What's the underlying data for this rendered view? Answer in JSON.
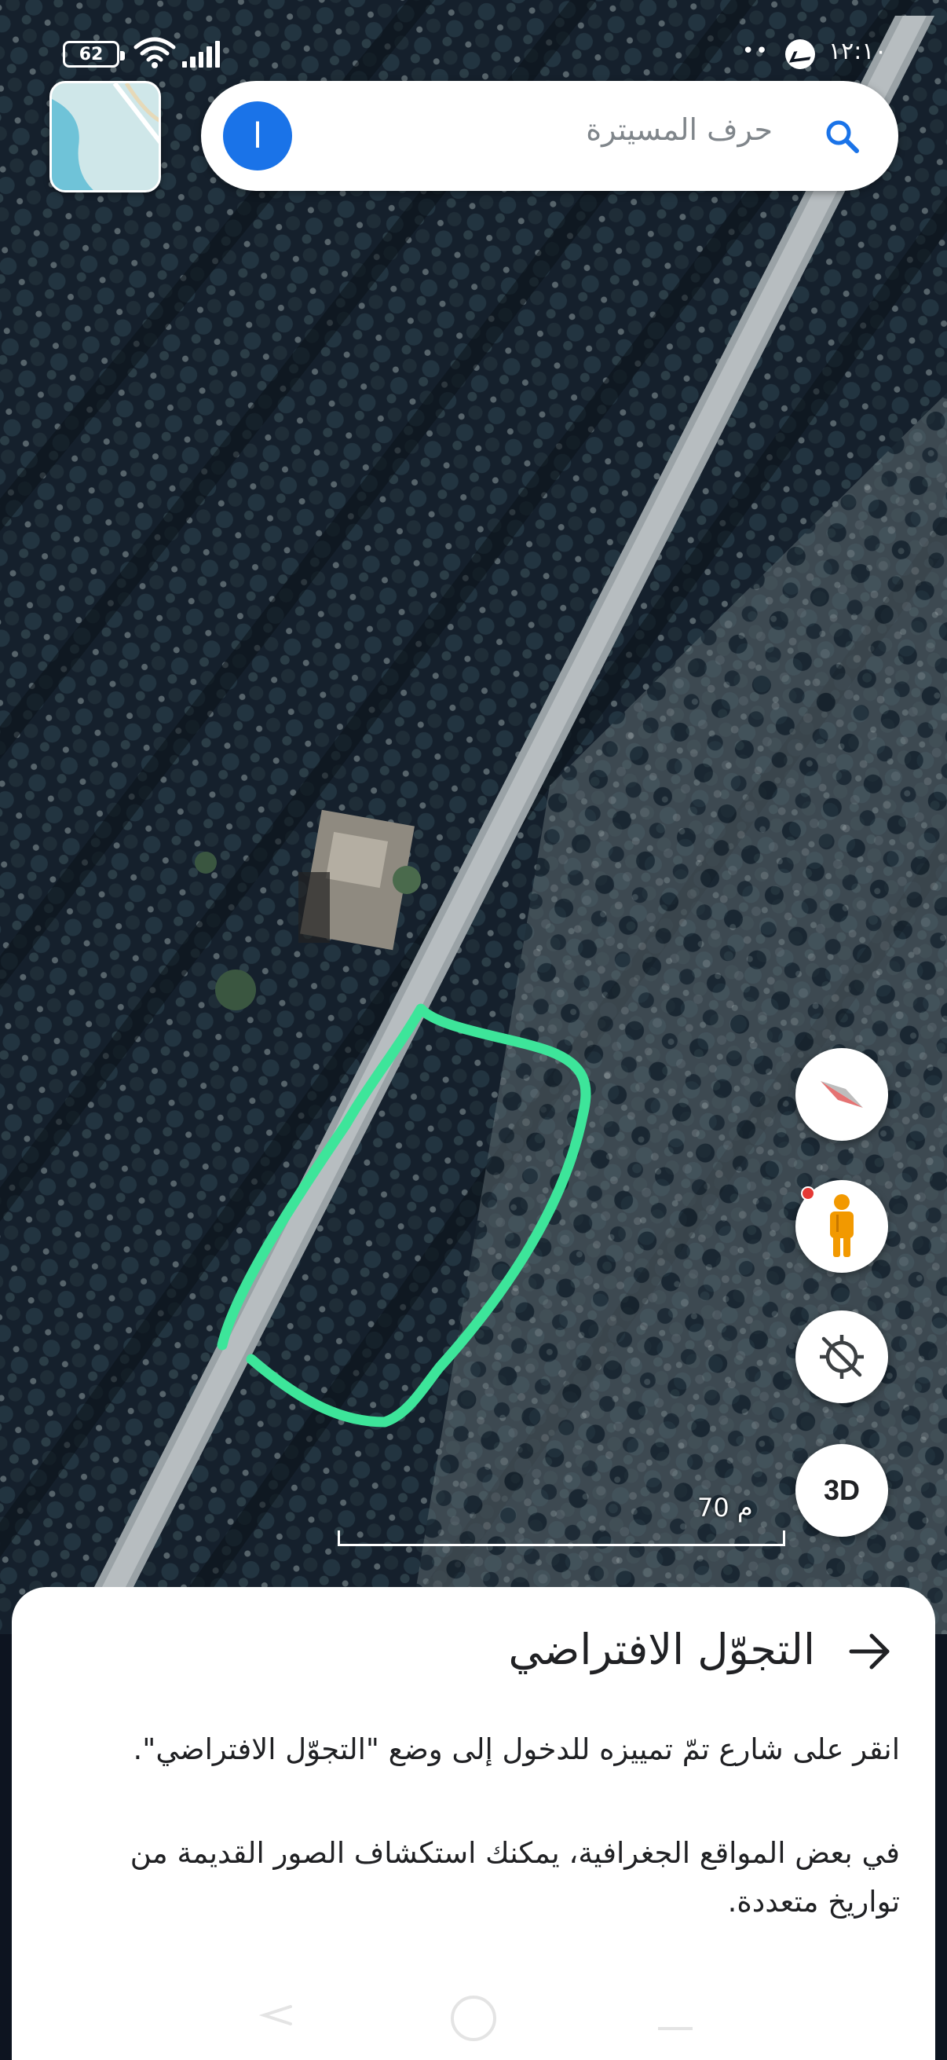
{
  "status_bar": {
    "battery": "62",
    "time": "١٢:١٠",
    "dots": "••"
  },
  "search": {
    "avatar_letter": "ا",
    "placeholder": "حرف المسيترة"
  },
  "controls": {
    "compass": "compass-icon",
    "street_view": "pegman-icon",
    "location": "location-off-icon",
    "three_d_label": "3D"
  },
  "scale": {
    "label": "70 م"
  },
  "sheet": {
    "title": "التجوّل الافتراضي",
    "paragraph_1": "انقر على شارع تمّ تمييزه للدخول إلى وضع \"التجوّل الافتراضي\".",
    "paragraph_2": "في بعض المواقع الجغرافية، يمكنك استكشاف الصور القديمة من تواريخ متعددة."
  },
  "colors": {
    "outline": "#3de59a",
    "accent": "#1a73e8"
  }
}
